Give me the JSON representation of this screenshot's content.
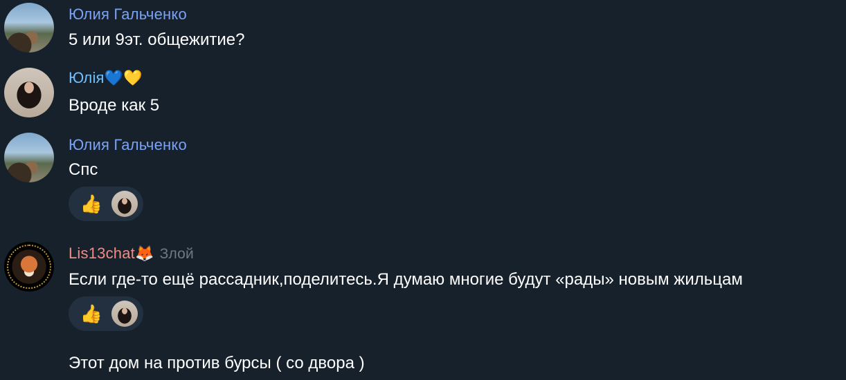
{
  "colors": {
    "background": "#17212b",
    "name_julia": "#7aa2f7",
    "name_yulia": "#6ec1ff",
    "name_lis": "#f08c84",
    "reaction_bg": "#22303f",
    "title_gray": "#6d7a86"
  },
  "messages": [
    {
      "author": "Юлия Гальченко",
      "avatar": "avatar-photo-julia",
      "text": "5 или 9эт. общежитие?"
    },
    {
      "author": "Юлія",
      "author_emoji": "💙💛",
      "avatar": "avatar-photo-yulia",
      "text": "Вроде как 5"
    },
    {
      "author": "Юлия Гальченко",
      "avatar": "avatar-photo-julia",
      "text": "Спс",
      "reactions": [
        {
          "emoji": "👍",
          "by": "avatar-photo-yulia"
        }
      ]
    },
    {
      "author": "Lis13chat",
      "author_emoji": "🦊",
      "author_title": "Злой",
      "avatar": "avatar-fox-logo",
      "text": "Если где-то ещё рассадник,поделитесь.Я думаю многие будут «рады» новым жильцам",
      "reactions": [
        {
          "emoji": "👍",
          "by": "avatar-photo-yulia"
        }
      ],
      "followup_text": "Этот дом на против бурсы ( со двора )"
    }
  ]
}
